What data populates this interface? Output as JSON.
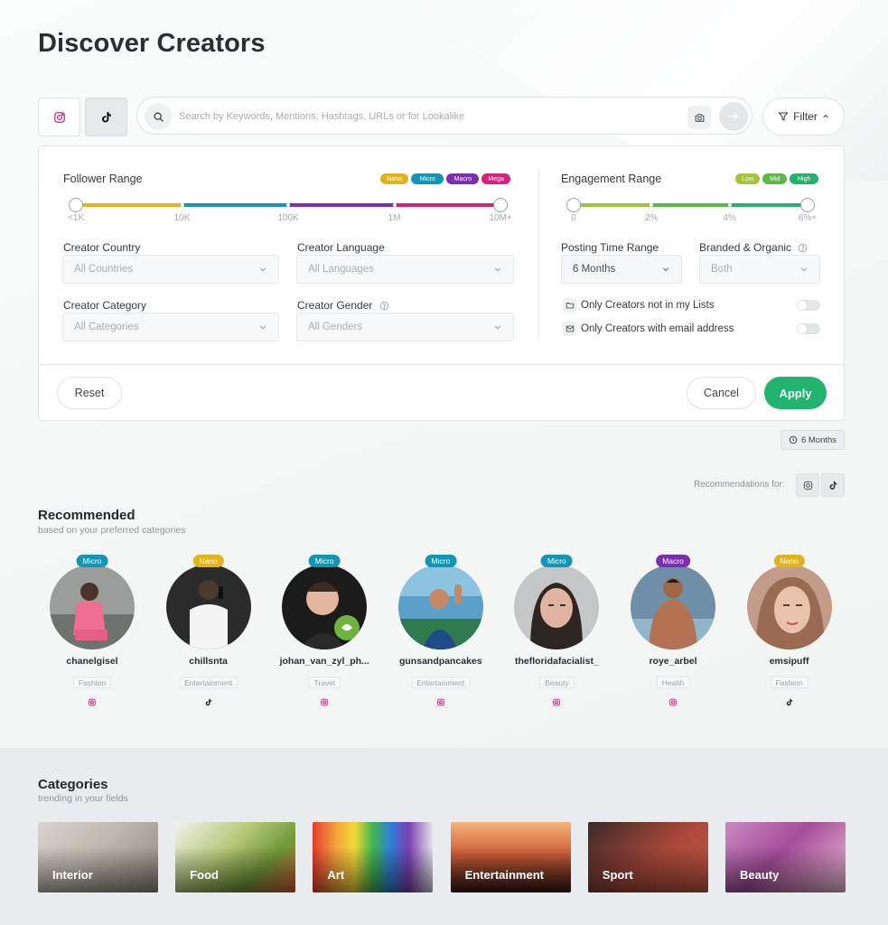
{
  "page": {
    "title": "Discover Creators"
  },
  "search": {
    "placeholder": "Search by Keywords, Mentions, Hashtags, URLs or for Lookalike",
    "filter_label": "Filter"
  },
  "filters": {
    "follower_range": {
      "label": "Follower Range",
      "tiers": [
        {
          "name": "Nano",
          "color": "#e2b41b"
        },
        {
          "name": "Micro",
          "color": "#1495b4"
        },
        {
          "name": "Macro",
          "color": "#7b2fb0"
        },
        {
          "name": "Mega",
          "color": "#d4227e"
        }
      ],
      "ticks": [
        "<1K",
        "10K",
        "100K",
        "1M",
        "10M+"
      ]
    },
    "engagement_range": {
      "label": "Engagement Range",
      "tiers": [
        {
          "name": "Low",
          "color": "#a4c43c"
        },
        {
          "name": "Mid",
          "color": "#5db84a"
        },
        {
          "name": "High",
          "color": "#25b06c"
        }
      ],
      "ticks": [
        "0",
        "2%",
        "4%",
        "6%+"
      ]
    },
    "creator_country": {
      "label": "Creator Country",
      "value": "All Countries"
    },
    "creator_language": {
      "label": "Creator Language",
      "value": "All Languages"
    },
    "creator_category": {
      "label": "Creator Category",
      "value": "All Categories"
    },
    "creator_gender": {
      "label": "Creator Gender",
      "value": "All Genders"
    },
    "posting_time": {
      "label": "Posting Time Range",
      "value": "6 Months"
    },
    "branded_organic": {
      "label": "Branded & Organic",
      "value": "Both"
    },
    "only_not_in_lists": {
      "label": "Only Creators not in my Lists",
      "on": false
    },
    "only_with_email": {
      "label": "Only Creators with email address",
      "on": false
    },
    "reset_label": "Reset",
    "cancel_label": "Cancel",
    "apply_label": "Apply"
  },
  "time_badge": "6 Months",
  "recommendations_for": "Recommendations for:",
  "recommended": {
    "title": "Recommended",
    "subtitle": "based on your preferred categories",
    "creators": [
      {
        "name": "chanelgisel",
        "tier": "Micro",
        "category": "Fashion",
        "platform": "instagram"
      },
      {
        "name": "chillsnta",
        "tier": "Nano",
        "category": "Entertainment",
        "platform": "tiktok"
      },
      {
        "name": "johan_van_zyl_ph...",
        "tier": "Micro",
        "category": "Travel",
        "platform": "instagram"
      },
      {
        "name": "gunsandpancakes",
        "tier": "Micro",
        "category": "Entertainment",
        "platform": "instagram"
      },
      {
        "name": "thefloridafacialist_",
        "tier": "Micro",
        "category": "Beauty",
        "platform": "instagram"
      },
      {
        "name": "roye_arbel",
        "tier": "Macro",
        "category": "Health",
        "platform": "instagram"
      },
      {
        "name": "emsipuff",
        "tier": "Nano",
        "category": "Fashion",
        "platform": "tiktok"
      }
    ]
  },
  "categories": {
    "title": "Categories",
    "subtitle": "trending in your fields",
    "items": [
      "Interior",
      "Food",
      "Art",
      "Entertainment",
      "Sport",
      "Beauty"
    ]
  },
  "colors": {
    "accent": "#20b46e"
  }
}
